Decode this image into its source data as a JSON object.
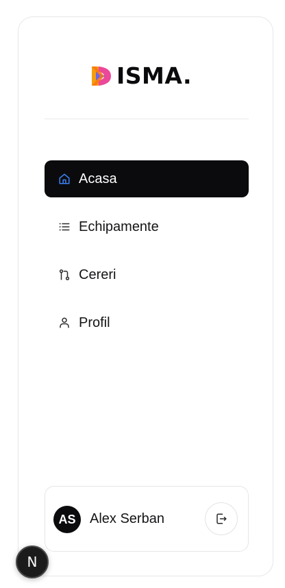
{
  "brand": {
    "name": "ISMA.",
    "logo_colors": [
      "#f59e0b",
      "#ec4899",
      "#6366f1"
    ]
  },
  "nav": {
    "items": [
      {
        "label": "Acasa",
        "icon": "home-icon",
        "active": true
      },
      {
        "label": "Echipamente",
        "icon": "list-icon",
        "active": false
      },
      {
        "label": "Cereri",
        "icon": "git-pull-request-icon",
        "active": false
      },
      {
        "label": "Profil",
        "icon": "user-icon",
        "active": false
      }
    ]
  },
  "user": {
    "initials": "AS",
    "name": "Alex Serban",
    "logout_icon": "logout-icon"
  },
  "dev_badge": {
    "letter": "N",
    "icon": "nextjs-icon"
  },
  "colors": {
    "active_bg": "#0b0b0e",
    "active_icon": "#3b82f6",
    "border": "#e6e6e9"
  }
}
